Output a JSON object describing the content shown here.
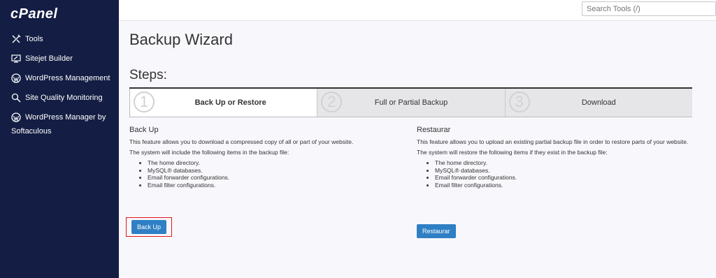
{
  "sidebar": {
    "logo": "cPanel",
    "items": [
      {
        "label": "Tools",
        "icon": "tools-icon"
      },
      {
        "label": "Sitejet Builder",
        "icon": "sitejet-icon"
      },
      {
        "label": "WordPress Management",
        "icon": "wordpress-icon"
      },
      {
        "label": "Site Quality Monitoring",
        "icon": "magnifier-icon"
      },
      {
        "label": "WordPress Manager by",
        "label2": "Softaculous",
        "icon": "wordpress-icon"
      }
    ]
  },
  "search": {
    "placeholder": "Search Tools (/)"
  },
  "page": {
    "title": "Backup Wizard",
    "steps_title": "Steps:"
  },
  "steps": [
    {
      "num": "1",
      "label": "Back Up or Restore",
      "active": true
    },
    {
      "num": "2",
      "label": "Full or Partial Backup",
      "active": false
    },
    {
      "num": "3",
      "label": "Download",
      "active": false
    }
  ],
  "backup": {
    "title": "Back Up",
    "desc": "This feature allows you to download a compressed copy of all or part of your website.",
    "intro": "The system will include the following items in the backup file:",
    "items": [
      "The home directory.",
      "MySQL® databases.",
      "Email forwarder configurations.",
      "Email filter configurations."
    ],
    "button": "Back Up"
  },
  "restore": {
    "title": "Restaurar",
    "desc": "This feature allows you to upload an existing partial backup file in order to restore parts of your website.",
    "intro": "The system will restore the following items if they exist in the backup file:",
    "items": [
      "The home directory.",
      "MySQL® databases.",
      "Email forwarder configurations.",
      "Email filter configurations."
    ],
    "button": "Restaurar"
  },
  "colors": {
    "sidebar": "#141e44",
    "button": "#2f7fc4",
    "highlight": "#e3181c"
  }
}
